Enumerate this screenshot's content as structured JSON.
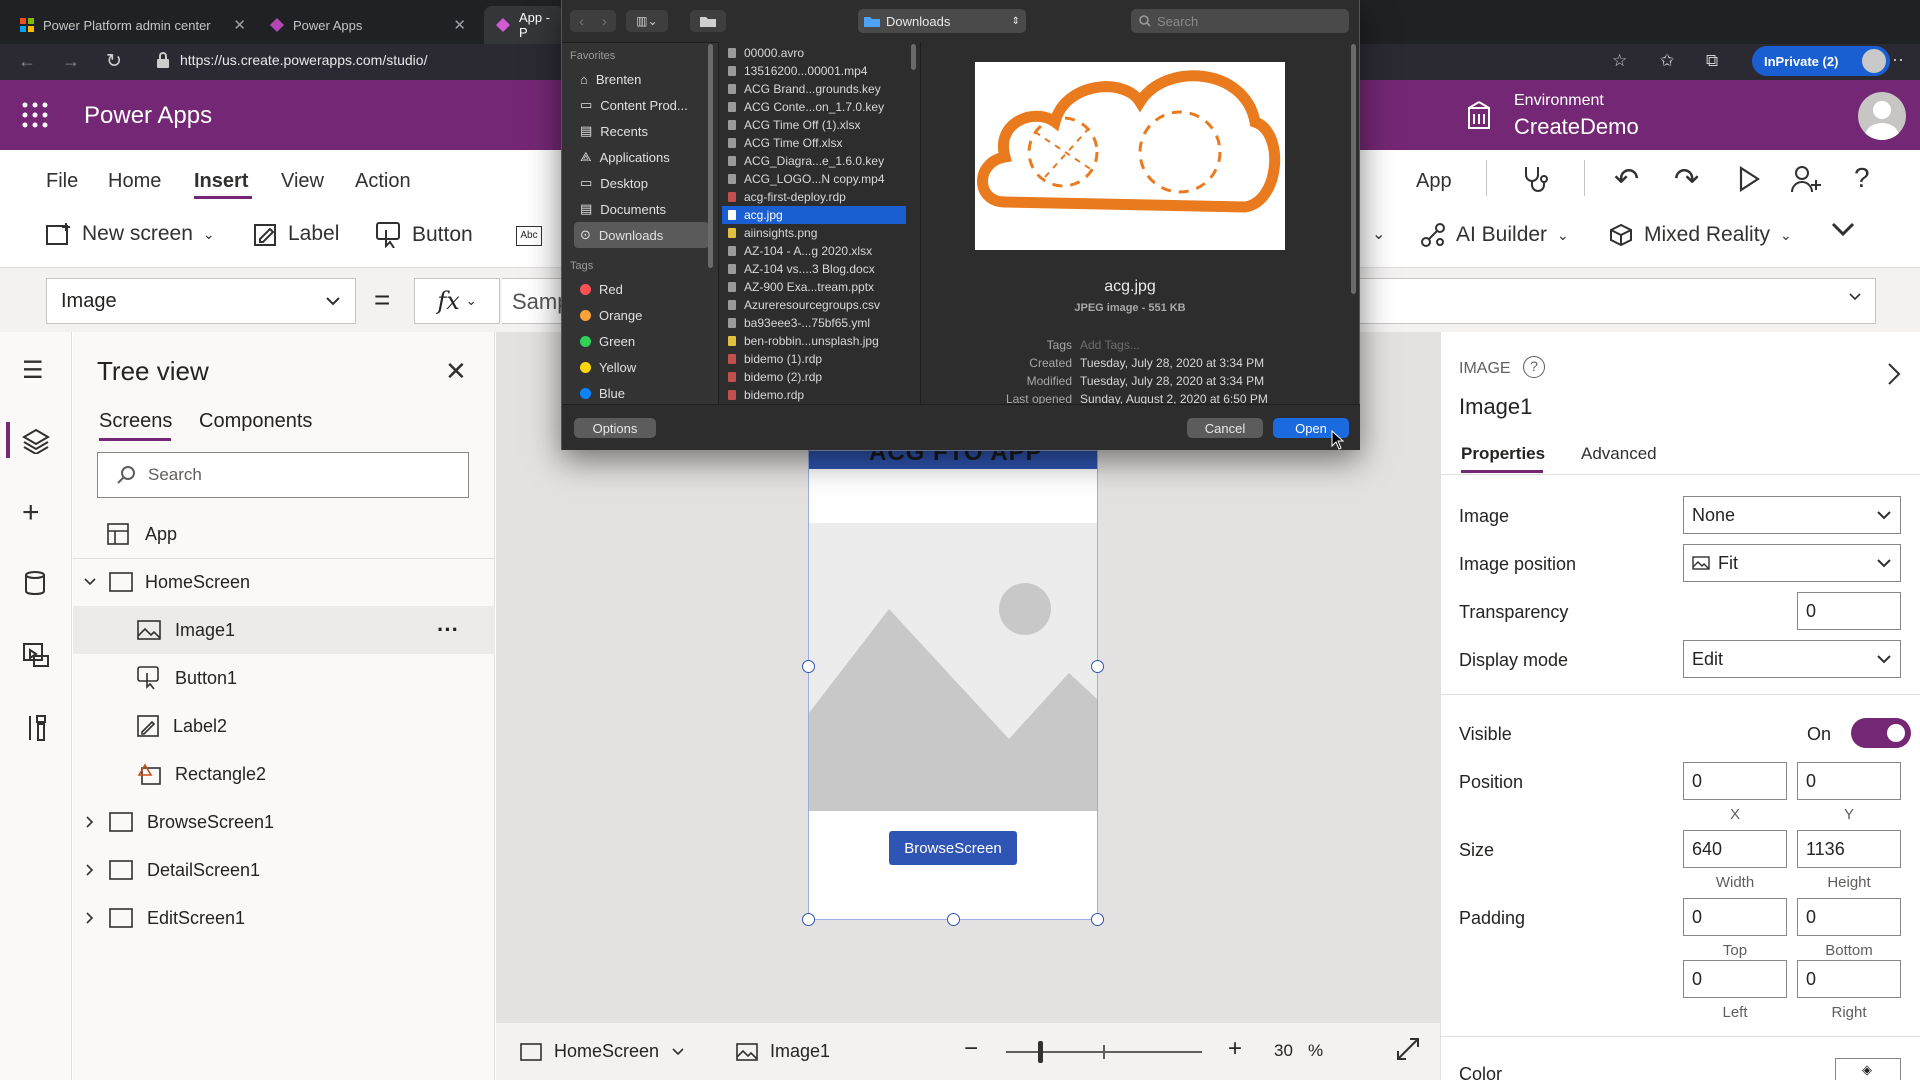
{
  "browser": {
    "tabs": [
      {
        "label": "Power Platform admin center"
      },
      {
        "label": "Power Apps"
      },
      {
        "label": "App - P"
      }
    ],
    "url": "https://us.create.powerapps.com/studio/",
    "inprivate": "InPrivate (2)"
  },
  "app": {
    "title": "Power Apps",
    "env_label": "Environment",
    "env_name": "CreateDemo"
  },
  "menu": [
    "File",
    "Home",
    "Insert",
    "View",
    "Action"
  ],
  "menu_active": "Insert",
  "ribbon": {
    "new_screen": "New screen",
    "label": "Label",
    "button": "Button",
    "ai_builder": "AI Builder",
    "mixed_reality": "Mixed Reality",
    "app": "App"
  },
  "formula": {
    "property": "Image",
    "fx": "fx",
    "value": "Samp"
  },
  "tree": {
    "title": "Tree view",
    "tabs": [
      "Screens",
      "Components"
    ],
    "search_placeholder": "Search",
    "app_label": "App",
    "home_screen": "HomeScreen",
    "children": [
      "Image1",
      "Button1",
      "Label2",
      "Rectangle2"
    ],
    "screens": [
      "BrowseScreen1",
      "DetailScreen1",
      "EditScreen1"
    ],
    "more": "···"
  },
  "canvas": {
    "header_text": "ACG FTO APP",
    "button_label": "BrowseScreen"
  },
  "statusbar": {
    "screen": "HomeScreen",
    "control": "Image1",
    "zoom": "30",
    "zoom_unit": "%",
    "minus": "−",
    "plus": "+"
  },
  "panel": {
    "type": "IMAGE",
    "name": "Image1",
    "tabs": [
      "Properties",
      "Advanced"
    ],
    "image_label": "Image",
    "image_value": "None",
    "position_label": "Image position",
    "position_value": "Fit",
    "transparency_label": "Transparency",
    "transparency_value": "0",
    "display_mode_label": "Display mode",
    "display_mode_value": "Edit",
    "visible_label": "Visible",
    "visible_value": "On",
    "pos_label": "Position",
    "x": "0",
    "y": "0",
    "x_label": "X",
    "y_label": "Y",
    "size_label": "Size",
    "width": "640",
    "height": "1136",
    "width_label": "Width",
    "height_label": "Height",
    "padding_label": "Padding",
    "top": "0",
    "bottom": "0",
    "left": "0",
    "right": "0",
    "top_label": "Top",
    "bottom_label": "Bottom",
    "left_label": "Left",
    "right_label": "Right",
    "color_label": "Color"
  },
  "dialog": {
    "location": "Downloads",
    "search_placeholder": "Search",
    "favorites_label": "Favorites",
    "favorites": [
      "Brenten",
      "Content Prod...",
      "Recents",
      "Applications",
      "Desktop",
      "Documents",
      "Downloads"
    ],
    "tags_label": "Tags",
    "tags": [
      {
        "name": "Red",
        "color": "#ff5257"
      },
      {
        "name": "Orange",
        "color": "#f7a33a"
      },
      {
        "name": "Green",
        "color": "#30d158"
      },
      {
        "name": "Yellow",
        "color": "#ffd60a"
      },
      {
        "name": "Blue",
        "color": "#0a84ff"
      }
    ],
    "files": [
      "00000.avro",
      "13516200...00001.mp4",
      "ACG Brand...grounds.key",
      "ACG Conte...on_1.7.0.key",
      "ACG Time Off (1).xlsx",
      "ACG Time Off.xlsx",
      "ACG_Diagra...e_1.6.0.key",
      "ACG_LOGO...N copy.mp4",
      "acg-first-deploy.rdp",
      "acg.jpg",
      "aiinsights.png",
      "AZ-104 - A...g 2020.xlsx",
      "AZ-104 vs....3 Blog.docx",
      "AZ-900 Exa...tream.pptx",
      "Azureresourcegroups.csv",
      "ba93eee3-...75bf65.yml",
      "ben-robbin...unsplash.jpg",
      "bidemo (1).rdp",
      "bidemo (2).rdp",
      "bidemo.rdp"
    ],
    "selected_file": "acg.jpg",
    "preview_name": "acg.jpg",
    "preview_kind": "JPEG image - 551 KB",
    "tags_field_label": "Tags",
    "tags_field_placeholder": "Add Tags...",
    "created_label": "Created",
    "created_value": "Tuesday, July 28, 2020 at 3:34 PM",
    "modified_label": "Modified",
    "modified_value": "Tuesday, July 28, 2020 at 3:34 PM",
    "opened_label": "Last opened",
    "opened_value": "Sunday, August 2, 2020 at 6:50 PM",
    "options": "Options",
    "cancel": "Cancel",
    "open": "Open"
  },
  "colors": {
    "brand_purple": "#742774",
    "accent_blue": "#2f55b4",
    "selection_blue": "#1a5fd1"
  }
}
